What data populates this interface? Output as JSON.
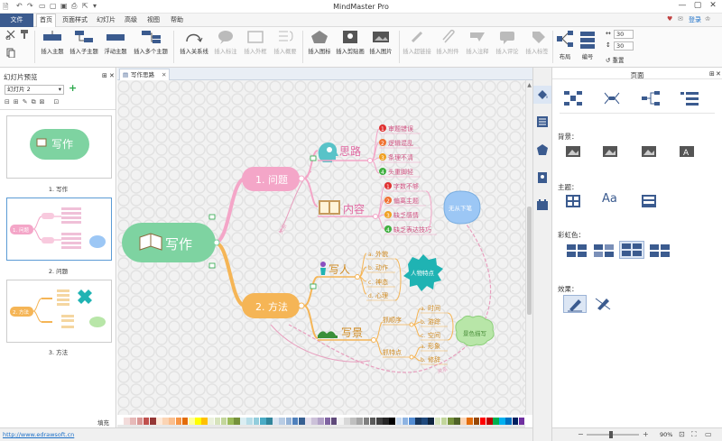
{
  "app": {
    "title": "MindMaster Pro"
  },
  "titlebar": {
    "login": "登录"
  },
  "menubar": {
    "file": "文件",
    "items": [
      "首页",
      "页面样式",
      "幻灯片",
      "高级",
      "视图",
      "帮助"
    ]
  },
  "ribbon": {
    "buttons": [
      {
        "label": "插入主题",
        "icon": "topic-icon"
      },
      {
        "label": "插入子主题",
        "icon": "subtopic-icon"
      },
      {
        "label": "浮动主题",
        "icon": "floating-topic-icon"
      },
      {
        "label": "插入多个主题",
        "icon": "multi-topic-icon"
      },
      {
        "label": "插入关系线",
        "icon": "relationship-icon"
      },
      {
        "label": "插入标注",
        "icon": "callout-icon"
      },
      {
        "label": "插入外框",
        "icon": "boundary-icon"
      },
      {
        "label": "插入概要",
        "icon": "summary-icon"
      },
      {
        "label": "插入图标",
        "icon": "mark-icon"
      },
      {
        "label": "插入剪贴画",
        "icon": "clipart-icon"
      },
      {
        "label": "插入图片",
        "icon": "image-icon"
      },
      {
        "label": "插入超链接",
        "icon": "hyperlink-icon"
      },
      {
        "label": "插入附件",
        "icon": "attachment-icon"
      },
      {
        "label": "插入注释",
        "icon": "note-icon"
      },
      {
        "label": "插入评论",
        "icon": "comment-icon"
      },
      {
        "label": "插入标签",
        "icon": "tag-icon"
      },
      {
        "label": "布局",
        "icon": "layout-icon"
      },
      {
        "label": "编号",
        "icon": "numbering-icon"
      }
    ],
    "spin1": "30",
    "spin2": "30",
    "reset": "重置"
  },
  "left_panel": {
    "title": "幻灯片预览",
    "slide_select": "幻灯片 2",
    "thumbnails": [
      {
        "caption": "1. 写作",
        "text": "写作"
      },
      {
        "caption": "2. 问题",
        "text": "1. 问题"
      },
      {
        "caption": "3. 方法",
        "text": "2. 方法"
      }
    ]
  },
  "tab": {
    "label": "写作思路"
  },
  "mindmap": {
    "central": "写作",
    "branch1": "1. 问题",
    "branch2": "2. 方法",
    "sub_silu": "思路",
    "silu_items": [
      "审题错误",
      "逻辑混乱",
      "条理不清",
      "头重脚轻"
    ],
    "sub_neirong": "内容",
    "neirong_items": [
      "字数不够",
      "偏离主题",
      "缺乏感情",
      "缺乏表达技巧"
    ],
    "callout1": "无从下笔",
    "sub_xieren": "写人",
    "xieren_items": [
      "外貌",
      "动作",
      "神态",
      "心理"
    ],
    "callout2": "人物特点",
    "sub_xiejing": "写景",
    "xiejing_group1": "抓顺序",
    "xiejing_group1_items": [
      "时间",
      "游踪",
      "空间"
    ],
    "xiejing_group2": "抓特点",
    "xiejing_group2_items": [
      "形象",
      "修辞"
    ],
    "callout3": "景色描写",
    "rel_label1": "关系",
    "rel_label2": "关系"
  },
  "status": {
    "fill_label": "填充",
    "url": "http://www.edrawsoft.cn",
    "zoom": "90%"
  },
  "right_panel": {
    "title": "页面",
    "background_label": "背景：",
    "theme_label": "主题：",
    "rainbow_label": "彩虹色：",
    "effect_label": "效果："
  },
  "colors": {
    "accent": "#3b5b8f",
    "central": "#7ed3a1",
    "branch1": "#f4a6c8",
    "branch2": "#f5b556",
    "callout": "#9cc7f5",
    "callout_green": "#b8e6a8",
    "callout_teal": "#1fb3b3",
    "relation": "#e8a0bf",
    "num_red": "#e03030",
    "num_orange": "#f0a020",
    "num_green": "#40b040"
  }
}
